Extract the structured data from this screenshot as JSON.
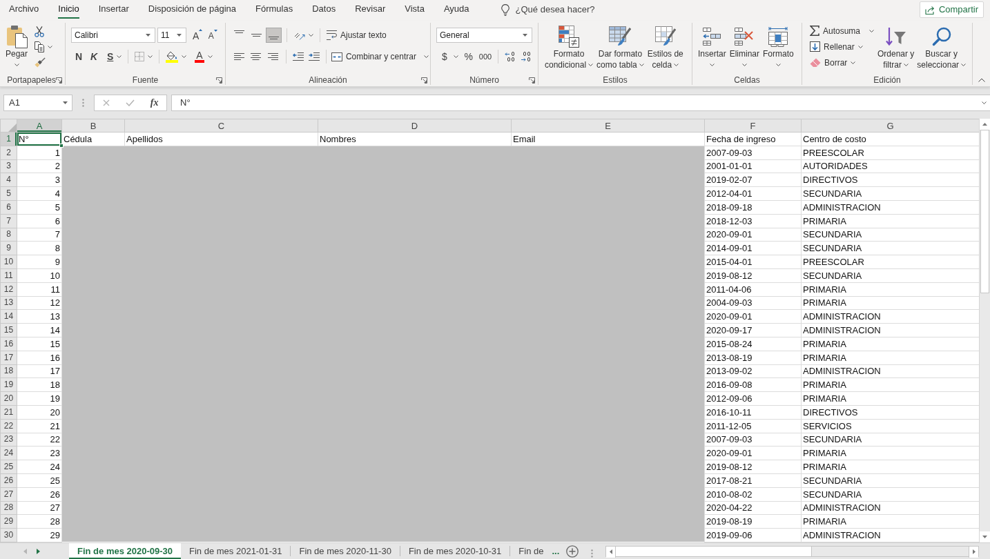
{
  "menu_tabs": [
    {
      "label": "Archivo",
      "selected": false
    },
    {
      "label": "Inicio",
      "selected": true
    },
    {
      "label": "Insertar",
      "selected": false
    },
    {
      "label": "Disposición de página",
      "selected": false
    },
    {
      "label": "Fórmulas",
      "selected": false
    },
    {
      "label": "Datos",
      "selected": false
    },
    {
      "label": "Revisar",
      "selected": false
    },
    {
      "label": "Vista",
      "selected": false
    },
    {
      "label": "Ayuda",
      "selected": false
    }
  ],
  "search": {
    "placeholder": "¿Qué desea hacer?"
  },
  "share_button": "Compartir",
  "ribbon_groups": [
    {
      "kind": "clipboard",
      "label": "Portapapeles",
      "dialog_launcher": true,
      "paste": {
        "lines": [
          "Pegar"
        ]
      }
    },
    {
      "kind": "font",
      "label": "Fuente",
      "dialog_launcher": true,
      "font_name": "Calibri",
      "font_size": "11",
      "grow": "A",
      "shrink": "A",
      "bold": "N",
      "italic": "K",
      "underline": "S",
      "font_color": "A"
    },
    {
      "kind": "alignment",
      "label": "Alineación",
      "dialog_launcher": true,
      "vertical_alignment": [
        {
          "selected": false
        },
        {
          "selected": false
        },
        {
          "selected": true
        }
      ],
      "wrap_text": "Ajustar texto",
      "merge": "Combinar y centrar"
    },
    {
      "kind": "number",
      "label": "Número",
      "dialog_launcher": true,
      "format": "General",
      "currency": "$",
      "percent": "%",
      "thousands": "000"
    },
    {
      "kind": "styles",
      "label": "Estilos",
      "dialog_launcher": false,
      "buttons": [
        {
          "lines": [
            "Formato",
            "condicional"
          ]
        },
        {
          "lines": [
            "Dar formato",
            "como tabla"
          ]
        },
        {
          "lines": [
            "Estilos de",
            "celda"
          ]
        }
      ]
    },
    {
      "kind": "cells",
      "label": "Celdas",
      "dialog_launcher": false,
      "buttons": [
        {
          "lines": [
            "Insertar"
          ]
        },
        {
          "lines": [
            "Eliminar"
          ]
        },
        {
          "lines": [
            "Formato"
          ]
        }
      ]
    },
    {
      "kind": "editing",
      "label": "Edición",
      "dialog_launcher": false,
      "small_buttons": [
        "Autosuma",
        "Rellenar",
        "Borrar"
      ],
      "buttons": [
        {
          "lines": [
            "Ordenar y",
            "filtrar"
          ]
        },
        {
          "lines": [
            "Buscar y",
            "seleccionar"
          ]
        }
      ]
    }
  ],
  "formula_bar": {
    "name_box": "A1",
    "cancel_disabled": true,
    "enter_disabled": true,
    "function_button": "fx",
    "value": "N°"
  },
  "sheet": {
    "columns": [
      {
        "label": "A",
        "selected": true
      },
      {
        "label": "B",
        "selected": false
      },
      {
        "label": "C",
        "selected": false
      },
      {
        "label": "D",
        "selected": false
      },
      {
        "label": "E",
        "selected": false
      },
      {
        "label": "F",
        "selected": false
      },
      {
        "label": "G",
        "selected": false
      }
    ],
    "header_row": {
      "row": "1",
      "selected": true,
      "cells": [
        "N°",
        "Cédula",
        "Apellidos",
        "Nombres",
        "Email",
        "Fecha de ingreso",
        "Centro de costo"
      ]
    },
    "rows": [
      {
        "row": "2",
        "selected": false,
        "number": "1",
        "fecha_de_ingreso": "2007-09-03",
        "centro_de_costo": "PREESCOLAR"
      },
      {
        "row": "3",
        "selected": false,
        "number": "2",
        "fecha_de_ingreso": "2001-01-01",
        "centro_de_costo": "AUTORIDADES"
      },
      {
        "row": "4",
        "selected": false,
        "number": "3",
        "fecha_de_ingreso": "2019-02-07",
        "centro_de_costo": "DIRECTIVOS"
      },
      {
        "row": "5",
        "selected": false,
        "number": "4",
        "fecha_de_ingreso": "2012-04-01",
        "centro_de_costo": "SECUNDARIA"
      },
      {
        "row": "6",
        "selected": false,
        "number": "5",
        "fecha_de_ingreso": "2018-09-18",
        "centro_de_costo": "ADMINISTRACION"
      },
      {
        "row": "7",
        "selected": false,
        "number": "6",
        "fecha_de_ingreso": "2018-12-03",
        "centro_de_costo": "PRIMARIA"
      },
      {
        "row": "8",
        "selected": false,
        "number": "7",
        "fecha_de_ingreso": "2020-09-01",
        "centro_de_costo": "SECUNDARIA"
      },
      {
        "row": "9",
        "selected": false,
        "number": "8",
        "fecha_de_ingreso": "2014-09-01",
        "centro_de_costo": "SECUNDARIA"
      },
      {
        "row": "10",
        "selected": false,
        "number": "9",
        "fecha_de_ingreso": "2015-04-01",
        "centro_de_costo": "PREESCOLAR"
      },
      {
        "row": "11",
        "selected": false,
        "number": "10",
        "fecha_de_ingreso": "2019-08-12",
        "centro_de_costo": "SECUNDARIA"
      },
      {
        "row": "12",
        "selected": false,
        "number": "11",
        "fecha_de_ingreso": "2011-04-06",
        "centro_de_costo": "PRIMARIA"
      },
      {
        "row": "13",
        "selected": false,
        "number": "12",
        "fecha_de_ingreso": "2004-09-03",
        "centro_de_costo": "PRIMARIA"
      },
      {
        "row": "14",
        "selected": false,
        "number": "13",
        "fecha_de_ingreso": "2020-09-01",
        "centro_de_costo": "ADMINISTRACION"
      },
      {
        "row": "15",
        "selected": false,
        "number": "14",
        "fecha_de_ingreso": "2020-09-17",
        "centro_de_costo": "ADMINISTRACION"
      },
      {
        "row": "16",
        "selected": false,
        "number": "15",
        "fecha_de_ingreso": "2015-08-24",
        "centro_de_costo": "PRIMARIA"
      },
      {
        "row": "17",
        "selected": false,
        "number": "16",
        "fecha_de_ingreso": "2013-08-19",
        "centro_de_costo": "PRIMARIA"
      },
      {
        "row": "18",
        "selected": false,
        "number": "17",
        "fecha_de_ingreso": "2013-09-02",
        "centro_de_costo": "ADMINISTRACION"
      },
      {
        "row": "19",
        "selected": false,
        "number": "18",
        "fecha_de_ingreso": "2016-09-08",
        "centro_de_costo": "PRIMARIA"
      },
      {
        "row": "20",
        "selected": false,
        "number": "19",
        "fecha_de_ingreso": "2012-09-06",
        "centro_de_costo": "PRIMARIA"
      },
      {
        "row": "21",
        "selected": false,
        "number": "20",
        "fecha_de_ingreso": "2016-10-11",
        "centro_de_costo": "DIRECTIVOS"
      },
      {
        "row": "22",
        "selected": false,
        "number": "21",
        "fecha_de_ingreso": "2011-12-05",
        "centro_de_costo": "SERVICIOS"
      },
      {
        "row": "23",
        "selected": false,
        "number": "22",
        "fecha_de_ingreso": "2007-09-03",
        "centro_de_costo": "SECUNDARIA"
      },
      {
        "row": "24",
        "selected": false,
        "number": "23",
        "fecha_de_ingreso": "2020-09-01",
        "centro_de_costo": "PRIMARIA"
      },
      {
        "row": "25",
        "selected": false,
        "number": "24",
        "fecha_de_ingreso": "2019-08-12",
        "centro_de_costo": "PRIMARIA"
      },
      {
        "row": "26",
        "selected": false,
        "number": "25",
        "fecha_de_ingreso": "2017-08-21",
        "centro_de_costo": "SECUNDARIA"
      },
      {
        "row": "27",
        "selected": false,
        "number": "26",
        "fecha_de_ingreso": "2010-08-02",
        "centro_de_costo": "SECUNDARIA"
      },
      {
        "row": "28",
        "selected": false,
        "number": "27",
        "fecha_de_ingreso": "2020-04-22",
        "centro_de_costo": "ADMINISTRACION"
      },
      {
        "row": "29",
        "selected": false,
        "number": "28",
        "fecha_de_ingreso": "2019-08-19",
        "centro_de_costo": "PRIMARIA"
      },
      {
        "row": "30",
        "selected": false,
        "number": "29",
        "fecha_de_ingreso": "2019-09-06",
        "centro_de_costo": "ADMINISTRACION"
      }
    ]
  },
  "sheet_nav": [
    {
      "disabled": true
    },
    {
      "disabled": false
    }
  ],
  "sheet_tabs": [
    {
      "label": "Fin de mes 2020-09-30",
      "selected": true
    },
    {
      "label": "Fin de mes 2021-01-31",
      "selected": false
    },
    {
      "label": "Fin de mes 2020-11-30",
      "selected": false
    },
    {
      "label": "Fin de mes 2020-10-31",
      "selected": false
    },
    {
      "label": "Fin de",
      "selected": false
    }
  ],
  "more_sheets": "..."
}
